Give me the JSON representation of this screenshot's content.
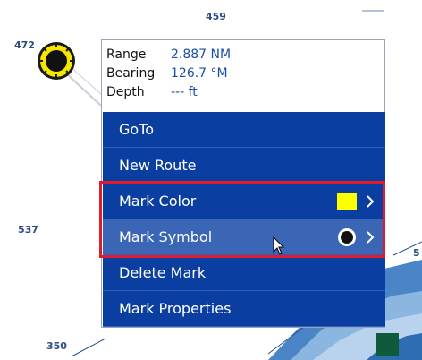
{
  "chart": {
    "depth_labels": {
      "d459": "459",
      "d472": "472",
      "d537": "537",
      "d350": "350",
      "d5": "5"
    }
  },
  "popup": {
    "info": {
      "range_label": "Range",
      "range_value": "2.887 NM",
      "bearing_label": "Bearing",
      "bearing_value": "126.7 °M",
      "depth_label": "Depth",
      "depth_value": "--- ft"
    },
    "menu": {
      "goto": "GoTo",
      "new_route": "New Route",
      "mark_color": "Mark Color",
      "mark_symbol": "Mark Symbol",
      "delete_mark": "Delete Mark",
      "mark_properties": "Mark Properties"
    },
    "mark_color_value": "#ffff00",
    "mark_symbol_icon": "black-circle-icon"
  },
  "colors": {
    "menu_bg": "#0a3ea0",
    "menu_hover": "#3b66b6",
    "highlight": "#e21b2b",
    "info_value": "#1b4ea6"
  }
}
